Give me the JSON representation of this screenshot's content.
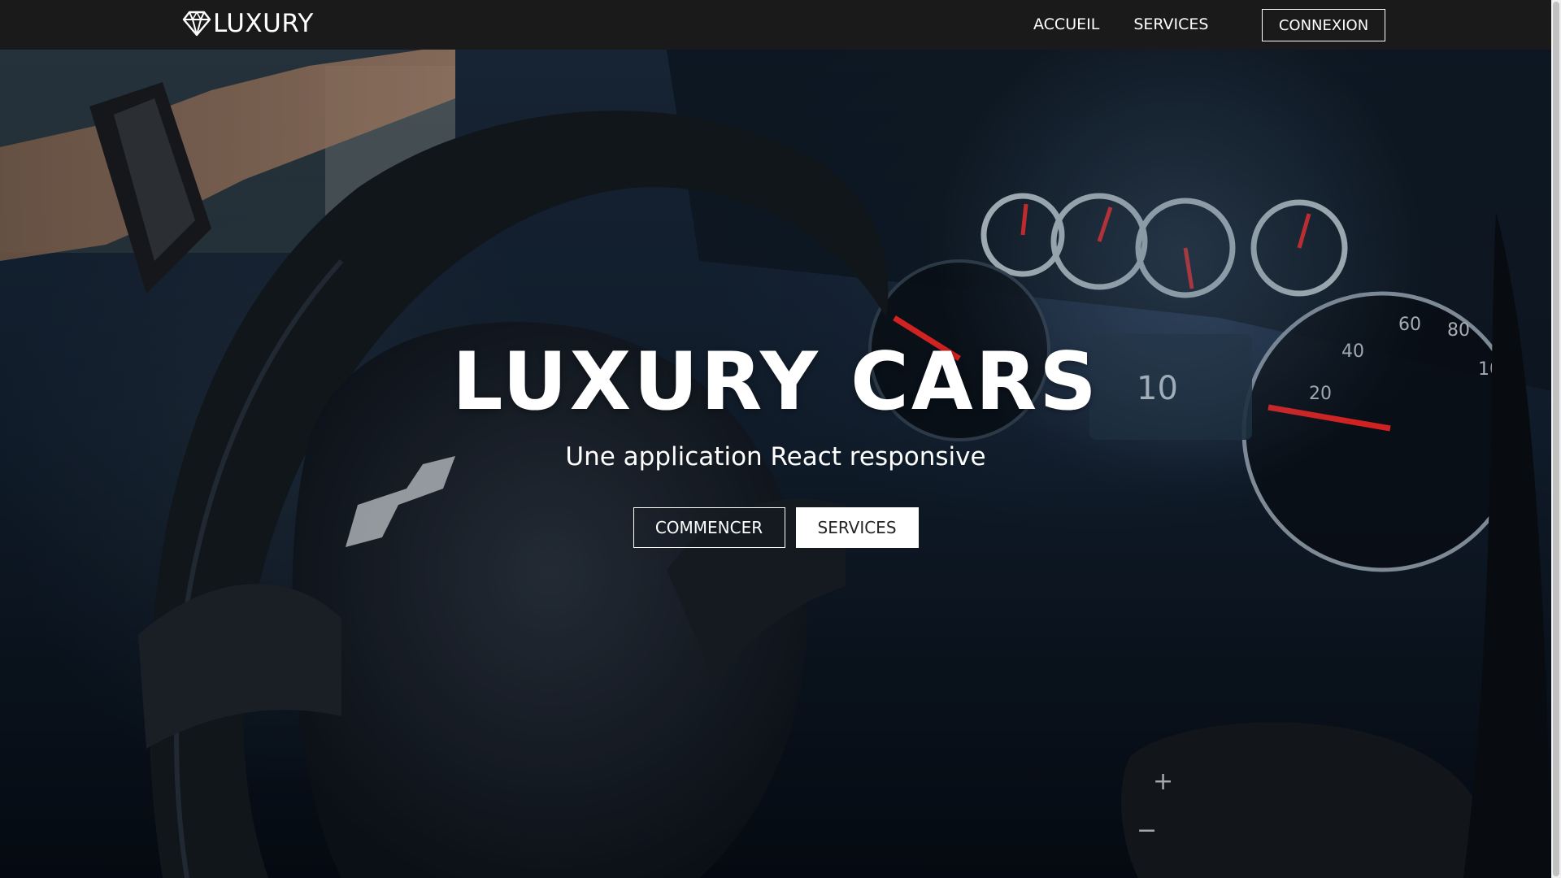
{
  "navbar": {
    "brand": "LUXURY",
    "brand_icon": "diamond-icon",
    "links": [
      {
        "label": "ACCUEIL"
      },
      {
        "label": "SERVICES"
      }
    ],
    "login_label": "CONNEXION",
    "background": "#1a1a1a"
  },
  "hero": {
    "title": "LUXURY CARS",
    "subtitle": "Une application React responsive",
    "primary_button": "COMMENCER",
    "secondary_button": "SERVICES",
    "background_image": "car-interior-dashboard"
  },
  "colors": {
    "text": "#ffffff",
    "gauge_needle": "#ff2a2a",
    "button_solid_text": "#242424"
  }
}
